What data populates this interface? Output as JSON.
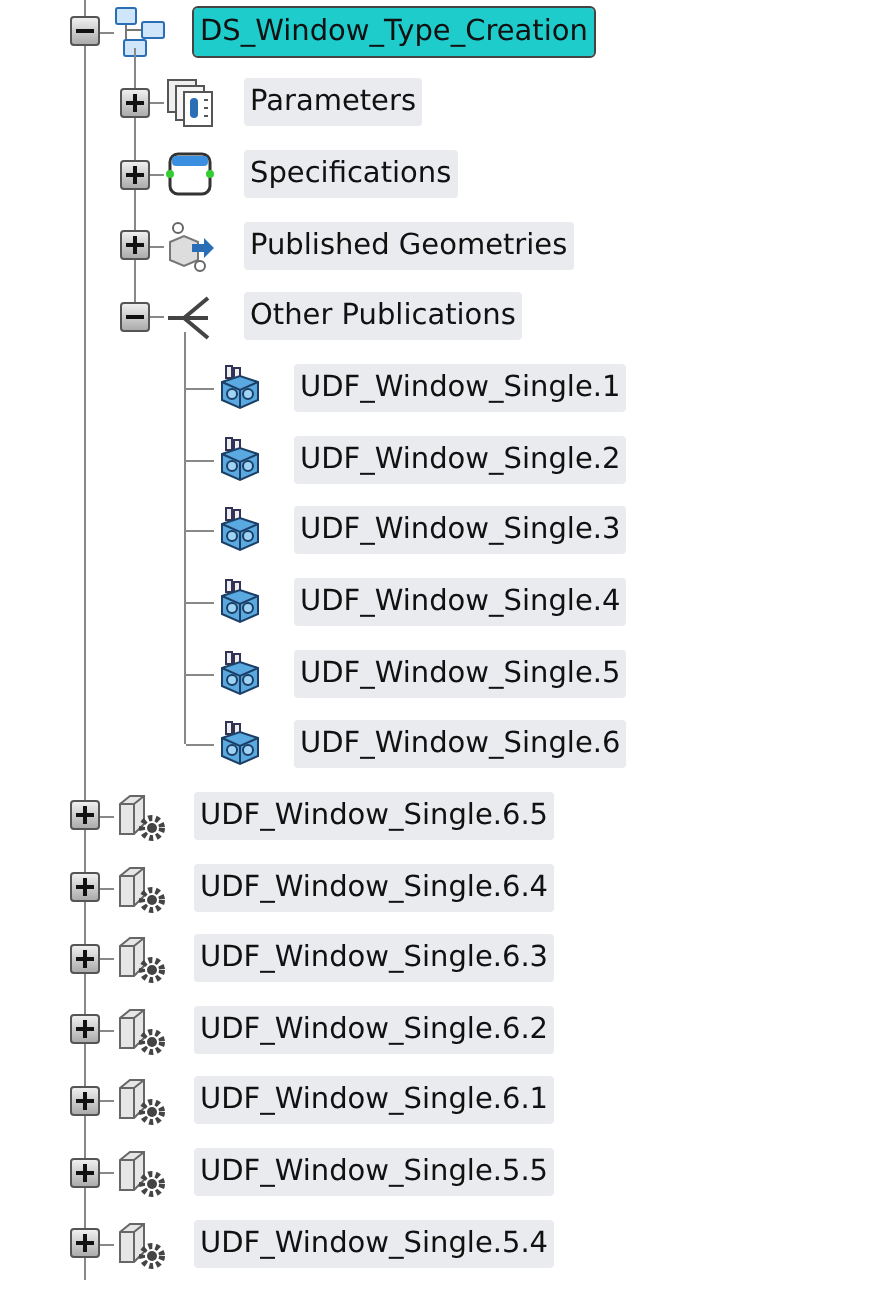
{
  "tree": [
    {
      "label": "DS_Window_Type_Creation",
      "kind": "product",
      "expanded": true,
      "selected": true,
      "children": [
        {
          "label": "Parameters",
          "kind": "parameters",
          "expanded": false,
          "selected": false
        },
        {
          "label": "Specifications",
          "kind": "specifications",
          "expanded": false,
          "selected": false
        },
        {
          "label": "Published Geometries",
          "kind": "published",
          "expanded": false,
          "selected": false
        },
        {
          "label": "Other Publications",
          "kind": "publications",
          "expanded": true,
          "selected": false,
          "children": [
            {
              "label": "UDF_Window_Single.1",
              "kind": "udf",
              "selected": false
            },
            {
              "label": "UDF_Window_Single.2",
              "kind": "udf",
              "selected": false
            },
            {
              "label": "UDF_Window_Single.3",
              "kind": "udf",
              "selected": false
            },
            {
              "label": "UDF_Window_Single.4",
              "kind": "udf",
              "selected": false
            },
            {
              "label": "UDF_Window_Single.5",
              "kind": "udf",
              "selected": false
            },
            {
              "label": "UDF_Window_Single.6",
              "kind": "udf",
              "selected": false
            }
          ]
        }
      ]
    },
    {
      "label": "UDF_Window_Single.6.5",
      "kind": "instance",
      "expanded": false,
      "selected": false
    },
    {
      "label": "UDF_Window_Single.6.4",
      "kind": "instance",
      "expanded": false,
      "selected": false
    },
    {
      "label": "UDF_Window_Single.6.3",
      "kind": "instance",
      "expanded": false,
      "selected": false
    },
    {
      "label": "UDF_Window_Single.6.2",
      "kind": "instance",
      "expanded": false,
      "selected": false
    },
    {
      "label": "UDF_Window_Single.6.1",
      "kind": "instance",
      "expanded": false,
      "selected": false
    },
    {
      "label": "UDF_Window_Single.5.5",
      "kind": "instance",
      "expanded": false,
      "selected": false
    },
    {
      "label": "UDF_Window_Single.5.4",
      "kind": "instance",
      "expanded": false,
      "selected": false
    }
  ]
}
